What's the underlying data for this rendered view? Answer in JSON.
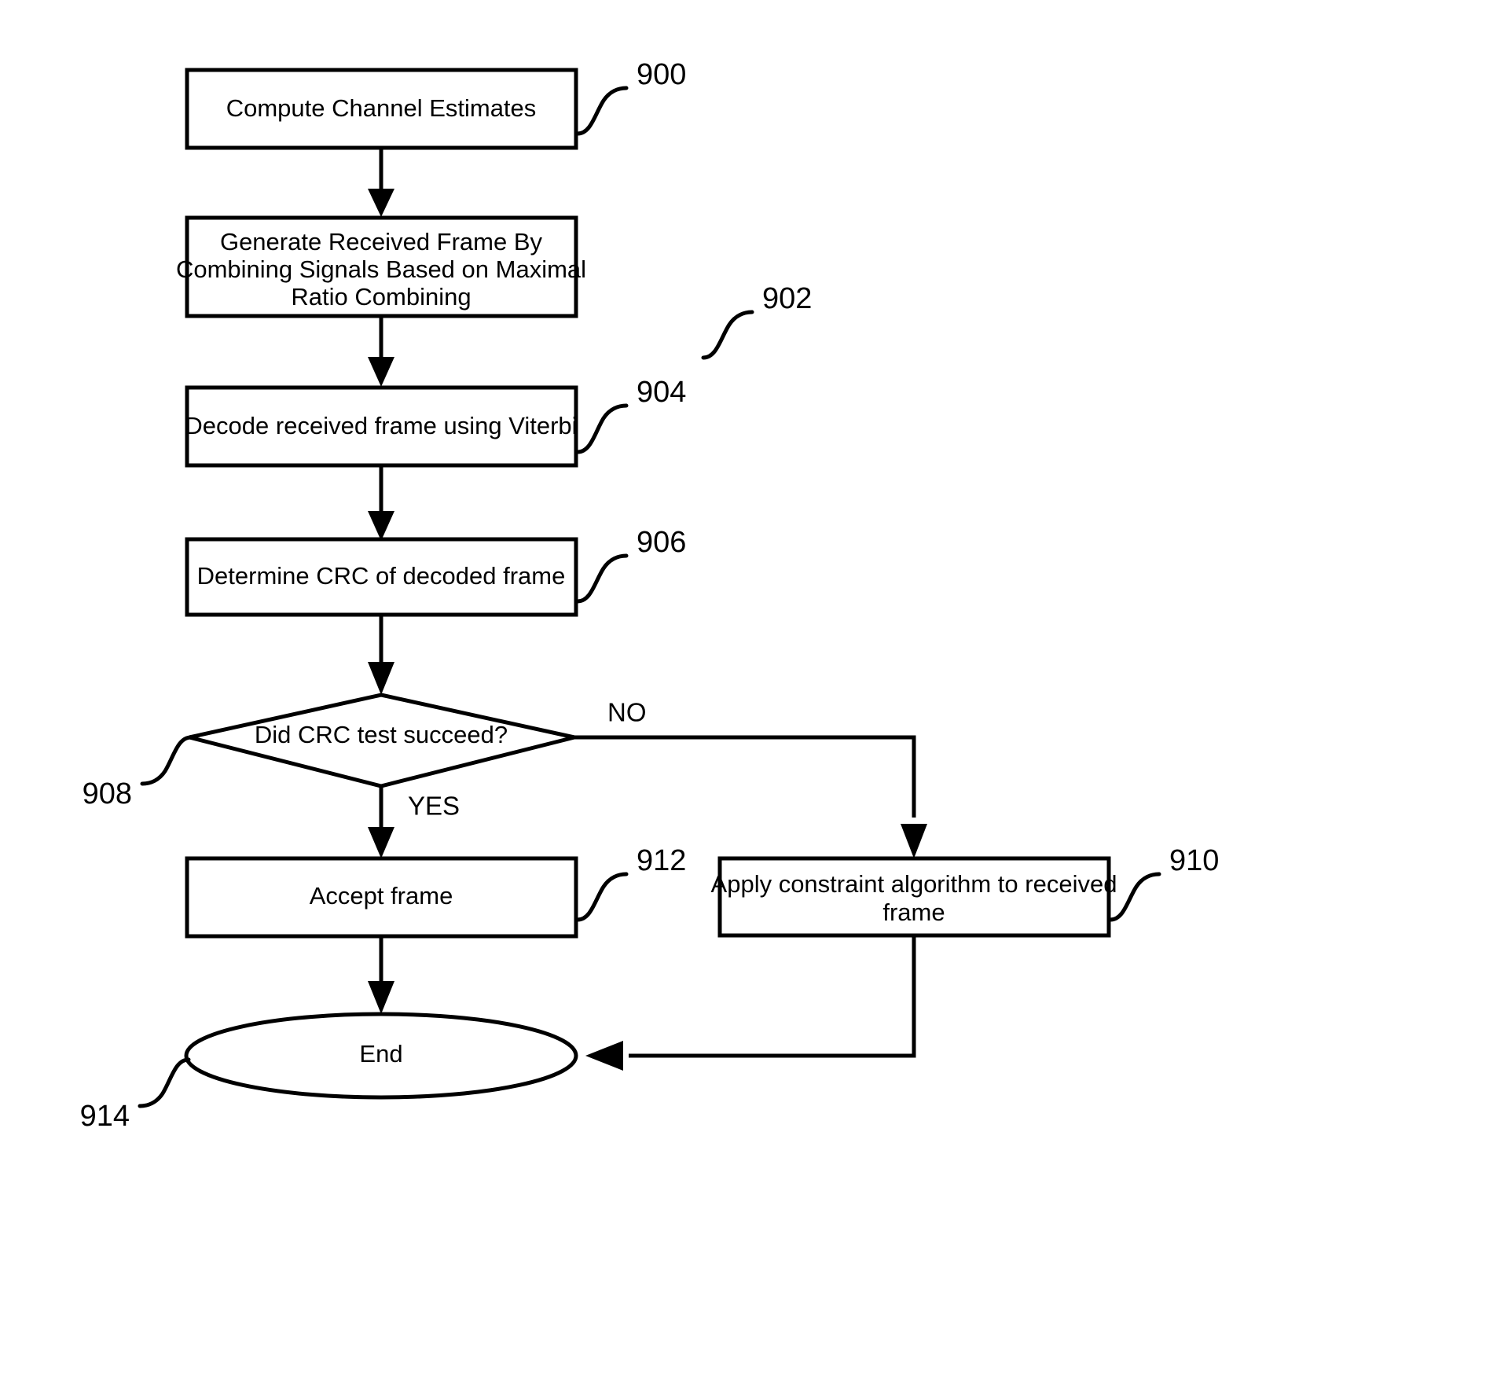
{
  "figure": {
    "type": "patent-flowchart",
    "background_color": "#ffffff",
    "stroke_color": "#000000"
  },
  "nodes": {
    "compute_channel_estimates": {
      "label": "Compute Channel Estimates",
      "ref": "900",
      "shape": "rectangle"
    },
    "generate_received_frame": {
      "label_line1": "Generate Received Frame By",
      "label_line2": "Combining Signals Based on Maximal",
      "label_line3": "Ratio Combining",
      "ref": "902",
      "shape": "rectangle"
    },
    "decode_received_frame": {
      "label": "Decode received frame using Viterbi",
      "ref": "904",
      "shape": "rectangle"
    },
    "determine_crc": {
      "label": "Determine CRC of decoded frame",
      "ref": "906",
      "shape": "rectangle"
    },
    "crc_decision": {
      "label": "Did CRC test succeed?",
      "ref": "908",
      "shape": "diamond"
    },
    "accept_frame": {
      "label": "Accept frame",
      "ref": "912",
      "shape": "rectangle"
    },
    "apply_constraint_algorithm": {
      "label_line1": "Apply constraint algorithm to received",
      "label_line2": "frame",
      "ref": "910",
      "shape": "rectangle"
    },
    "end_node": {
      "label": "End",
      "ref": "914",
      "shape": "ellipse"
    }
  },
  "edge_labels": {
    "no_branch": "NO",
    "yes_branch": "YES"
  }
}
